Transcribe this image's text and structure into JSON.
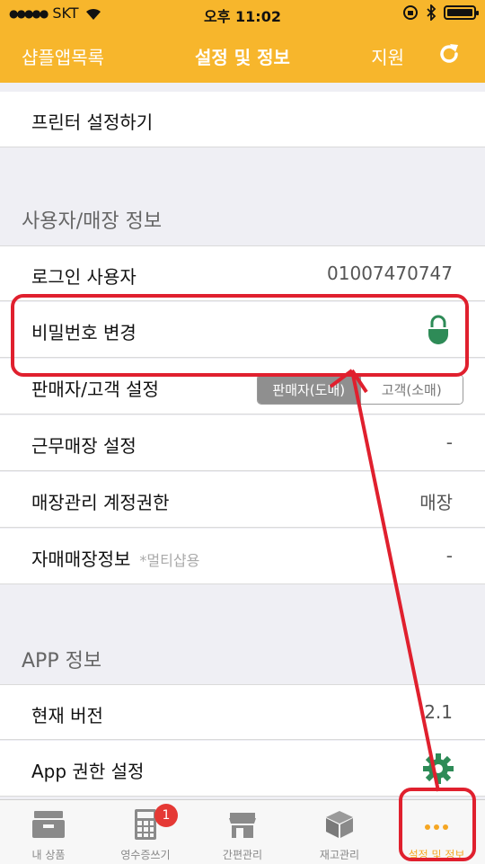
{
  "status": {
    "carrier": "SKT",
    "time": "오후 11:02"
  },
  "nav": {
    "back_label": "샵플앱목록",
    "title": "설정 및 정보",
    "support_label": "지원",
    "refresh_icon": "refresh-icon"
  },
  "printer": {
    "label": "프린터 설정하기"
  },
  "user_section": {
    "header": "사용자/매장 정보",
    "login_label": "로그인 사용자",
    "login_value": "01007470747",
    "password_label": "비밀번호 변경",
    "seller_label": "판매자/고객 설정",
    "seller_opt1": "판매자(도매)",
    "seller_opt2": "고객(소매)",
    "store_label": "근무매장 설정",
    "store_value": "-",
    "account_label": "매장관리 계정권한",
    "account_value": "매장",
    "self_label": "자매매장정보",
    "self_note": "*멀티샵용",
    "self_value": "-"
  },
  "app_section": {
    "header": "APP 정보",
    "version_label": "현재 버전",
    "version_value": "2.1",
    "perm_label": "App 권한 설정"
  },
  "tabs": [
    {
      "label": "내 상품",
      "icon": "archive-icon"
    },
    {
      "label": "영수증쓰기",
      "icon": "calculator-icon",
      "badge": "1"
    },
    {
      "label": "간편관리",
      "icon": "store-icon"
    },
    {
      "label": "재고관리",
      "icon": "box-icon"
    },
    {
      "label": "설정 및 정보",
      "icon": "more-icon"
    }
  ],
  "colors": {
    "brand": "#f7b62c",
    "lock": "#2e8b57",
    "annotation": "#e0202e",
    "active_tab": "#f5a623"
  }
}
